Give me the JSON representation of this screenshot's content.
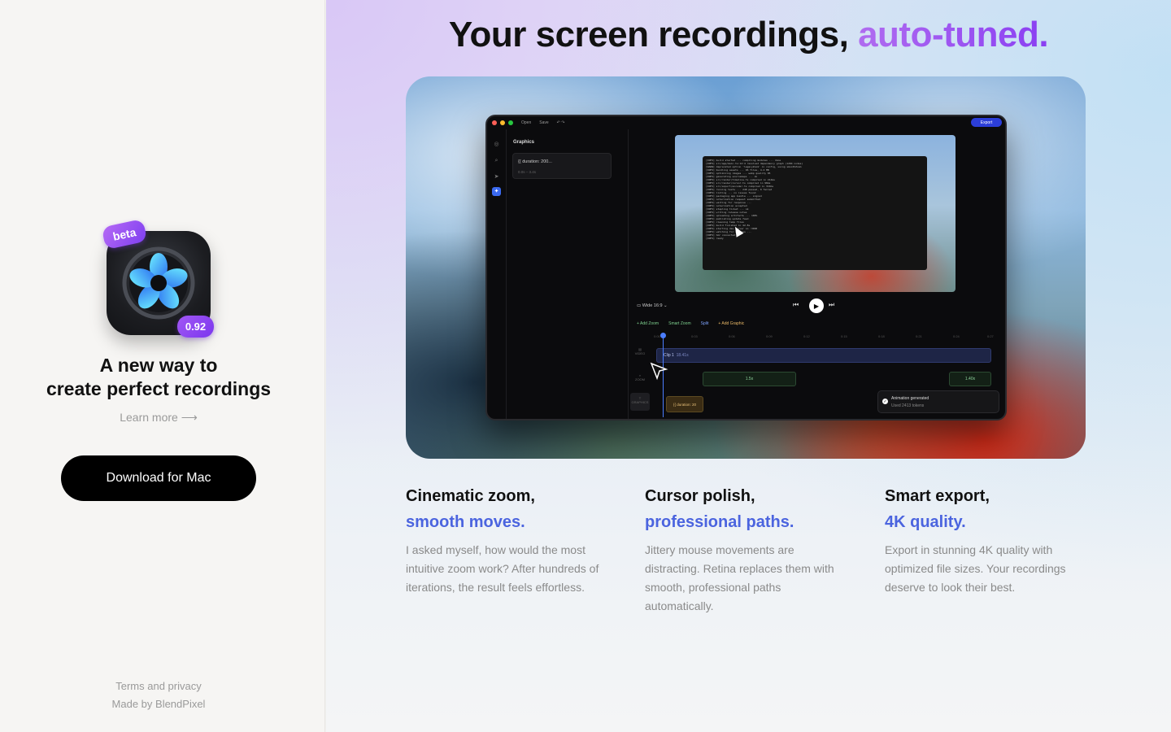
{
  "left": {
    "badge_beta": "beta",
    "version": "0.92",
    "tagline_line1": "A new way to",
    "tagline_line2": "create perfect recordings",
    "learn_more": "Learn more ⟶",
    "download_label": "Download for Mac",
    "terms": "Terms and privacy",
    "made_by": "Made by BlendPixel"
  },
  "headline": {
    "main": "Your screen recordings, ",
    "accent": "auto-tuned."
  },
  "mockup": {
    "toolbar": {
      "open": "Open",
      "save": "Save",
      "export": "Export"
    },
    "sidebar_title": "Graphics",
    "graphic_card_label": "{{ duration: 200...",
    "graphic_card_time": "0.0s – 3.4s",
    "aspect_label": "Wide 16:9",
    "tools": {
      "add_zoom": "+ Add Zoom",
      "smart_zoom": "Smart Zoom",
      "split": "Split",
      "add_graphic": "+ Add Graphic"
    },
    "ruler_ticks": [
      "0:00",
      "0:03",
      "0:06",
      "0:09",
      "0:12",
      "0:15",
      "0:18",
      "0:21",
      "0:24",
      "0:27"
    ],
    "track_labels": [
      "VIDEO",
      "ZOOM",
      "GRAPHICS"
    ],
    "clip_label": "Clip 1",
    "clip_duration": "18.41s",
    "zoom_seg_1": "1.5x",
    "zoom_seg_2": "1.40x",
    "graphic_seg": "{{ duration: 20",
    "toast_title": "Animation generated",
    "toast_sub": "Used 2413 tokens"
  },
  "features": [
    {
      "title": "Cinematic zoom,",
      "accent": "smooth moves.",
      "text": "I asked myself, how would the most intuitive zoom work? After hundreds of iterations, the result feels effortless."
    },
    {
      "title": "Cursor polish,",
      "accent": "professional paths.",
      "text": "Jittery mouse movements are distracting. Retina replaces them with smooth, professional paths automatically."
    },
    {
      "title": "Smart export,",
      "accent": "4K quality.",
      "text": "Export in stunning 4K quality with optimized file sizes. Your recordings deserve to look their best."
    }
  ],
  "colors": {
    "accent_purple": "#8a3ff2",
    "accent_blue": "#4b64df",
    "button_black": "#000000"
  },
  "icons": [
    "app-logo-icon",
    "arrow-right-icon",
    "play-icon",
    "cursor-icon",
    "check-icon"
  ]
}
